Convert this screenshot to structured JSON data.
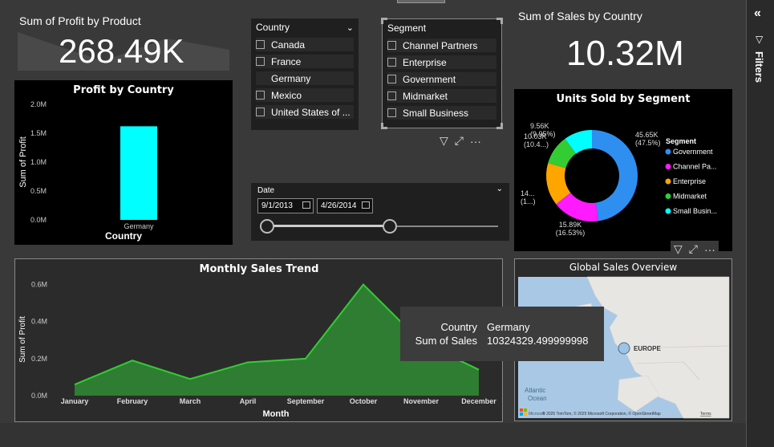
{
  "kpi_profit": {
    "label": "Sum of Profit by Product",
    "value": "268.49K"
  },
  "kpi_sales": {
    "label": "Sum of Sales by Country",
    "value": "10.32M"
  },
  "country_slicer": {
    "header": "Country",
    "items": [
      {
        "label": "Canada",
        "checked": false
      },
      {
        "label": "France",
        "checked": false
      },
      {
        "label": "Germany",
        "checked": true
      },
      {
        "label": "Mexico",
        "checked": false
      },
      {
        "label": "United States of ...",
        "checked": false
      }
    ]
  },
  "segment_slicer": {
    "header": "Segment",
    "items": [
      {
        "label": "Channel Partners"
      },
      {
        "label": "Enterprise"
      },
      {
        "label": "Government"
      },
      {
        "label": "Midmarket"
      },
      {
        "label": "Small Business"
      }
    ]
  },
  "date_slicer": {
    "header": "Date",
    "start": "9/1/2013",
    "end": "4/26/2014",
    "start_fraction": 0.0,
    "end_fraction": 0.53
  },
  "profit_by_country": {
    "title": "Profit by Country",
    "xlabel": "Country",
    "ylabel": "Sum of Profit",
    "yticks": [
      "2.0M",
      "1.5M",
      "1.0M",
      "0.5M",
      "0.0M"
    ],
    "ylim": [
      0,
      2000000
    ],
    "categories": [
      "Germany"
    ],
    "values": [
      1620000
    ],
    "bar_color": "#00ffff"
  },
  "units_by_segment": {
    "title": "Units Sold by Segment",
    "legend_title": "Segment",
    "segments": [
      {
        "name": "Government",
        "value": 45650,
        "label": "45.65K",
        "pct": "(47.5%)",
        "color": "#2e8ff0",
        "legend": "Government"
      },
      {
        "name": "Channel Partners",
        "value": 15890,
        "label": "15.89K",
        "pct": "(16.53%)",
        "color": "#ff1aff",
        "legend": "Channel Pa..."
      },
      {
        "name": "Enterprise",
        "value": 14500,
        "label": "14...",
        "pct": "(1...)",
        "color": "#ffa500",
        "legend": "Enterprise"
      },
      {
        "name": "Midmarket",
        "value": 10030,
        "label": "10.03K",
        "pct": "(10.4...)",
        "color": "#33cc33",
        "legend": "Midmarket"
      },
      {
        "name": "Small Business",
        "value": 9560,
        "label": "9.56K",
        "pct": "(9.95%)",
        "color": "#00ffff",
        "legend": "Small Busin..."
      }
    ]
  },
  "chart_data": [
    {
      "type": "bar",
      "title": "Profit by Country",
      "categories": [
        "Germany"
      ],
      "values": [
        1620000
      ],
      "xlabel": "Country",
      "ylabel": "Sum of Profit",
      "ylim": [
        0,
        2000000
      ]
    },
    {
      "type": "pie",
      "title": "Units Sold by Segment",
      "categories": [
        "Government",
        "Channel Partners",
        "Enterprise",
        "Midmarket",
        "Small Business"
      ],
      "values": [
        45650,
        15890,
        14500,
        10030,
        9560
      ]
    },
    {
      "type": "area",
      "title": "Monthly Sales Trend",
      "categories": [
        "January",
        "February",
        "March",
        "April",
        "September",
        "October",
        "November",
        "December"
      ],
      "values": [
        60000,
        190000,
        90000,
        180000,
        200000,
        600000,
        290000,
        140000
      ],
      "xlabel": "Month",
      "ylabel": "Sum of Profit",
      "ylim": [
        0,
        650000
      ]
    }
  ],
  "monthly_trend": {
    "title": "Monthly Sales Trend",
    "xlabel": "Month",
    "ylabel": "Sum of Profit",
    "yticks": [
      "0.6M",
      "0.4M",
      "0.2M",
      "0.0M"
    ],
    "ytick_values": [
      600000,
      400000,
      200000,
      0
    ],
    "ylim": [
      0,
      650000
    ],
    "categories": [
      "January",
      "February",
      "March",
      "April",
      "September",
      "October",
      "November",
      "December"
    ],
    "values": [
      60000,
      190000,
      90000,
      180000,
      200000,
      600000,
      290000,
      140000
    ],
    "line_color": "#33cc33",
    "fill_color": "#2e7d32"
  },
  "global_map": {
    "title": "Global Sales Overview",
    "region_label": "EUROPE",
    "ocean_label_1": "Atlantic",
    "ocean_label_2": "Ocean",
    "attribution": "© 2025 TomTom, © 2025 Microsoft Corporation, © OpenStreetMap",
    "terms": "Terms",
    "brand": "Microsoft"
  },
  "tooltip": {
    "k1": "Country",
    "v1": "Germany",
    "k2": "Sum of Sales",
    "v2": "10324329.499999998"
  },
  "filters_pane": {
    "label": "Filters"
  },
  "toolbar": {
    "filter": "▽",
    "focus": "⤢",
    "more": "···"
  }
}
